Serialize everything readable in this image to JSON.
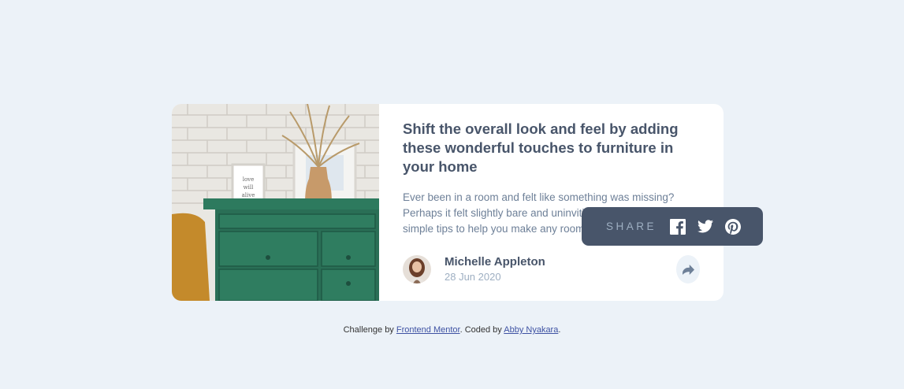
{
  "article": {
    "headline": "Shift the overall look and feel by adding these wonderful touches to furniture in your home",
    "excerpt": "Ever been in a room and felt like something was missing? Perhaps it felt slightly bare and uninviting. I've got some simple tips to help you make any room feel complete.",
    "image_alt": "drawers"
  },
  "author": {
    "name": "Michelle Appleton",
    "date": "28 Jun 2020"
  },
  "share": {
    "label": "SHARE",
    "icons": [
      "facebook-icon",
      "twitter-icon",
      "pinterest-icon"
    ]
  },
  "attribution": {
    "prefix": "Challenge by ",
    "link1": "Frontend Mentor",
    "middle": ". Coded by ",
    "link2": "Abby Nyakara",
    "suffix": "."
  },
  "colors": {
    "background": "#ecf2f8",
    "card": "#ffffff",
    "heading": "#48556a",
    "body_text": "#6e8098",
    "muted": "#9eafc2",
    "popup": "#48556a"
  }
}
